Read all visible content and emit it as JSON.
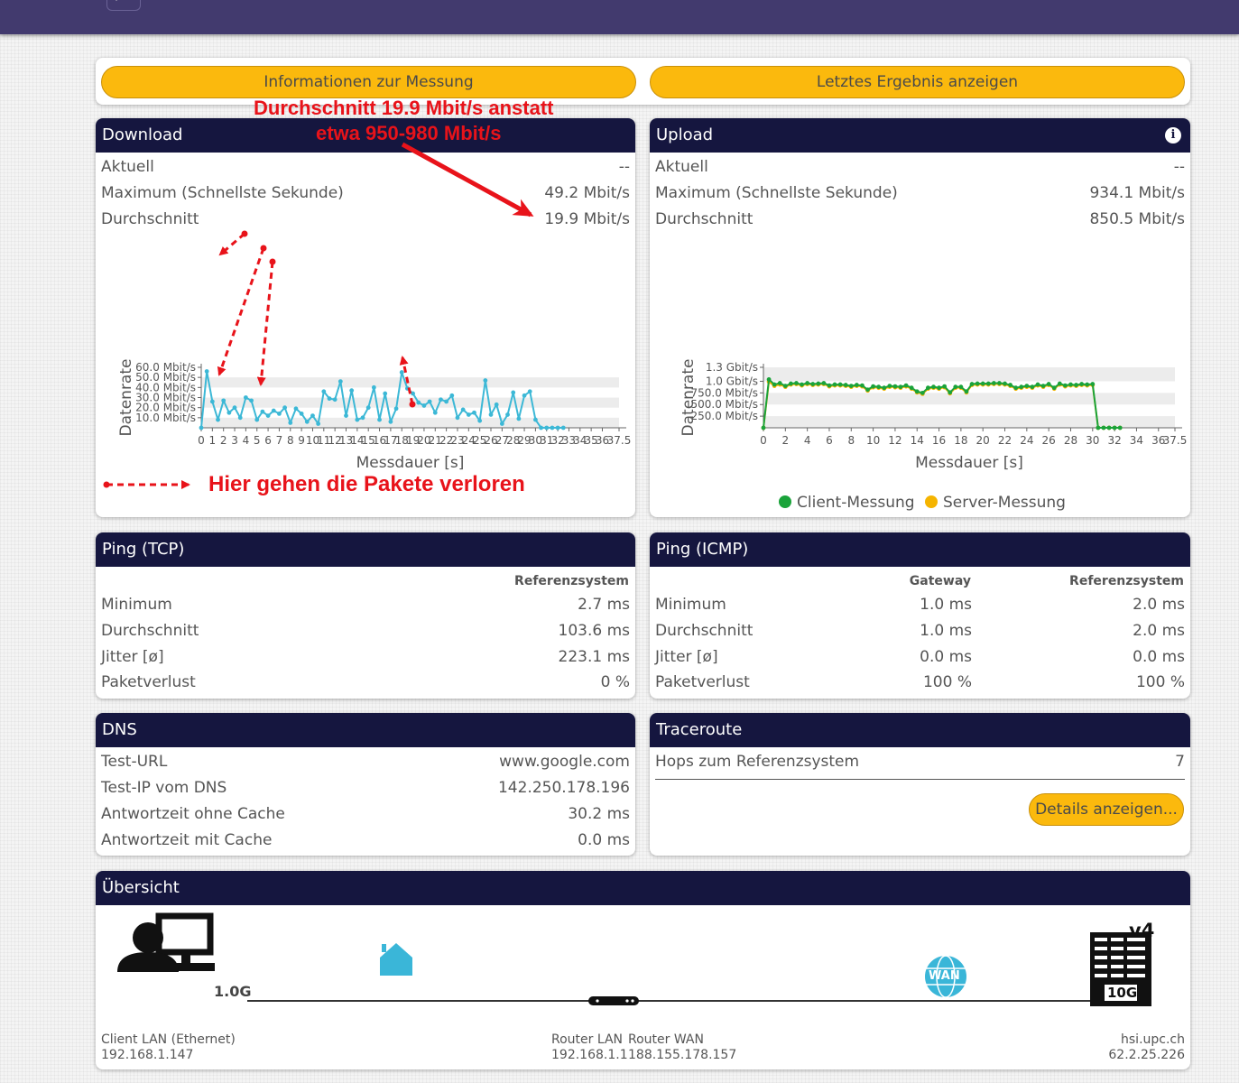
{
  "topbar": {
    "stub_label": "Q"
  },
  "actions": {
    "info_button": "Informationen zur Messung",
    "last_result_button": "Letztes Ergebnis anzeigen"
  },
  "download": {
    "title": "Download",
    "rows": [
      {
        "label": "Aktuell",
        "value": "--"
      },
      {
        "label": "Maximum (Schnellste Sekunde)",
        "value": "49.2 Mbit/s"
      },
      {
        "label": "Durchschnitt",
        "value": "19.9 Mbit/s"
      }
    ]
  },
  "upload": {
    "title": "Upload",
    "info_icon": "i",
    "rows": [
      {
        "label": "Aktuell",
        "value": "--"
      },
      {
        "label": "Maximum (Schnellste Sekunde)",
        "value": "934.1 Mbit/s"
      },
      {
        "label": "Durchschnitt",
        "value": "850.5 Mbit/s"
      }
    ],
    "legend_client": "Client-Messung",
    "legend_server": "Server-Messung"
  },
  "annotations": {
    "top_line1": "Durchschnitt 19.9 Mbit/s anstatt",
    "top_line2": "etwa 950-980 Mbit/s",
    "bottom": "Hier gehen die Pakete verloren"
  },
  "ping_tcp": {
    "title": "Ping (TCP)",
    "col": "Referenzsystem",
    "rows": [
      {
        "label": "Minimum",
        "value": "2.7 ms"
      },
      {
        "label": "Durchschnitt",
        "value": "103.6 ms"
      },
      {
        "label": "Jitter [ø]",
        "value": "223.1 ms"
      },
      {
        "label": "Paketverlust",
        "value": "0 %"
      }
    ]
  },
  "ping_icmp": {
    "title": "Ping (ICMP)",
    "col1": "Gateway",
    "col2": "Referenzsystem",
    "rows": [
      {
        "label": "Minimum",
        "gw": "1.0 ms",
        "ref": "2.0 ms"
      },
      {
        "label": "Durchschnitt",
        "gw": "1.0 ms",
        "ref": "2.0 ms"
      },
      {
        "label": "Jitter [ø]",
        "gw": "0.0 ms",
        "ref": "0.0 ms"
      },
      {
        "label": "Paketverlust",
        "gw": "100 %",
        "ref": "100 %"
      }
    ]
  },
  "dns": {
    "title": "DNS",
    "rows": [
      {
        "label": "Test-URL",
        "value": "www.google.com"
      },
      {
        "label": "Test-IP vom DNS",
        "value": "142.250.178.196"
      },
      {
        "label": "Antwortzeit ohne Cache",
        "value": "30.2 ms"
      },
      {
        "label": "Antwortzeit mit Cache",
        "value": "0.0 ms"
      }
    ]
  },
  "traceroute": {
    "title": "Traceroute",
    "hops_label": "Hops zum Referenzsystem",
    "hops_value": "7",
    "details_button": "Details anzeigen..."
  },
  "overview": {
    "title": "Übersicht",
    "client_speed": "1.0G",
    "lan_label": "LAN",
    "wan_label": "WAN",
    "server_speed": "10G",
    "server_ip_version": "v4",
    "client_name": "Client LAN (Ethernet)",
    "client_ip": "192.168.1.147",
    "router_lan_name": "Router LAN",
    "router_lan_ip": "192.168.1.1",
    "router_wan_name": "Router WAN",
    "router_wan_ip": "188.155.178.157",
    "server_name": "hsi.upc.ch",
    "server_ip": "62.2.25.226"
  },
  "colors": {
    "header_bg": "#15163f",
    "topbar_bg": "#423a6e",
    "button_yellow": "#fbb90d",
    "download_line": "#3cb8d6",
    "client_line": "#1aa33a",
    "server_line": "#f5b400",
    "annotation_red": "#e8131a"
  },
  "chart_data": [
    {
      "id": "download",
      "type": "line",
      "xlabel": "Messdauer [s]",
      "ylabel": "Datenrate",
      "xlim": [
        0,
        37.5
      ],
      "ylim": [
        0,
        60
      ],
      "y_ticks": [
        10,
        20,
        30,
        40,
        50,
        60
      ],
      "y_tick_labels": [
        "10.0 Mbit/s",
        "20.0 Mbit/s",
        "30.0 Mbit/s",
        "40.0 Mbit/s",
        "50.0 Mbit/s",
        "60.0 Mbit/s"
      ],
      "x_tick_labels": [
        "0",
        "1",
        "2",
        "3",
        "4",
        "5",
        "6",
        "7",
        "8",
        "9",
        "10",
        "11",
        "12",
        "13",
        "14",
        "15",
        "16",
        "17",
        "18",
        "19",
        "20",
        "21",
        "22",
        "23",
        "24",
        "25",
        "26",
        "27",
        "28",
        "29",
        "30",
        "31",
        "32",
        "33",
        "34",
        "35",
        "36",
        "37.5"
      ],
      "series": [
        {
          "x": [
            0,
            0.5,
            1,
            1.5,
            2,
            2.5,
            3,
            3.5,
            4,
            4.5,
            5,
            5.5,
            6,
            6.5,
            7,
            7.5,
            8,
            8.5,
            9,
            9.5,
            10,
            10.5,
            11,
            11.5,
            12,
            12.5,
            13,
            13.5,
            14,
            14.5,
            15,
            15.5,
            16,
            16.5,
            17,
            17.5,
            18,
            18.5,
            19,
            19.5,
            20,
            20.5,
            21,
            21.5,
            22,
            22.5,
            23,
            23.5,
            24,
            24.5,
            25,
            25.5,
            26,
            26.5,
            27,
            27.5,
            28,
            28.5,
            29,
            29.5,
            30,
            30.5,
            31,
            31.5,
            32,
            32.5
          ],
          "y": [
            0,
            56,
            26,
            8,
            27,
            15,
            20,
            10,
            30,
            27,
            8,
            16,
            12,
            17,
            14,
            20,
            5,
            19,
            14,
            6,
            12,
            4,
            36,
            29,
            28,
            46,
            12,
            37,
            8,
            10,
            20,
            40,
            8,
            34,
            6,
            19,
            55,
            39,
            34,
            25,
            22,
            26,
            15,
            28,
            26,
            32,
            10,
            18,
            13,
            15,
            7,
            47,
            13,
            23,
            4,
            13,
            35,
            9,
            32,
            36,
            8,
            0,
            0,
            0,
            0,
            0
          ]
        }
      ]
    },
    {
      "id": "upload",
      "type": "line",
      "xlabel": "Messdauer [s]",
      "ylabel": "Datenrate",
      "xlim": [
        0,
        37.5
      ],
      "ylim": [
        0,
        1300
      ],
      "y_ticks": [
        250,
        500,
        750,
        1000,
        1300
      ],
      "y_tick_labels": [
        "250.0 Mbit/s",
        "500.0 Mbit/s",
        "750.0 Mbit/s",
        "1.0 Gbit/s",
        "1.3 Gbit/s"
      ],
      "x_tick_labels": [
        "0",
        "2",
        "4",
        "6",
        "8",
        "10",
        "12",
        "14",
        "16",
        "18",
        "20",
        "22",
        "24",
        "26",
        "28",
        "30",
        "32",
        "34",
        "36",
        "37.5"
      ],
      "legend": "bottom",
      "series": [
        {
          "name": "Client-Messung",
          "x": [
            0,
            0.5,
            1,
            1.5,
            2,
            2.5,
            3,
            3.5,
            4,
            4.5,
            5,
            5.5,
            6,
            6.5,
            7,
            7.5,
            8,
            8.5,
            9,
            9.5,
            10,
            10.5,
            11,
            11.5,
            12,
            12.5,
            13,
            13.5,
            14,
            14.5,
            15,
            15.5,
            16,
            16.5,
            17,
            17.5,
            18,
            18.5,
            19,
            19.5,
            20,
            20.5,
            21,
            21.5,
            22,
            22.5,
            23,
            23.5,
            24,
            24.5,
            25,
            25.5,
            26,
            26.5,
            27,
            27.5,
            28,
            28.5,
            29,
            29.5,
            30,
            30.5,
            31,
            31.5,
            32,
            32.5
          ],
          "y": [
            0,
            1040,
            930,
            960,
            900,
            950,
            960,
            930,
            960,
            940,
            950,
            960,
            910,
            930,
            930,
            920,
            900,
            920,
            910,
            820,
            890,
            880,
            860,
            900,
            890,
            880,
            910,
            860,
            780,
            750,
            860,
            880,
            860,
            890,
            760,
            880,
            880,
            780,
            940,
            950,
            950,
            950,
            960,
            960,
            950,
            920,
            860,
            880,
            900,
            880,
            930,
            900,
            940,
            860,
            950,
            910,
            930,
            920,
            940,
            930,
            940,
            0,
            0,
            0,
            0,
            0
          ]
        },
        {
          "name": "Server-Messung",
          "x": [
            0,
            0.5,
            1,
            1.5,
            2,
            2.5,
            3,
            3.5,
            4,
            4.5,
            5,
            5.5,
            6,
            6.5,
            7,
            7.5,
            8,
            8.5,
            9,
            9.5,
            10,
            10.5,
            11,
            11.5,
            12,
            12.5,
            13,
            13.5,
            14,
            14.5,
            15,
            15.5,
            16,
            16.5,
            17,
            17.5,
            18,
            18.5,
            19,
            19.5,
            20,
            20.5,
            21,
            21.5,
            22,
            22.5,
            23,
            23.5,
            24,
            24.5,
            25,
            25.5,
            26,
            26.5,
            27,
            27.5,
            28,
            28.5,
            29,
            29.5,
            30,
            30.5,
            31,
            31.5,
            32,
            32.5
          ],
          "y": [
            0,
            990,
            900,
            930,
            880,
            930,
            940,
            910,
            940,
            920,
            930,
            940,
            890,
            910,
            910,
            900,
            880,
            900,
            890,
            800,
            870,
            860,
            840,
            880,
            870,
            860,
            890,
            840,
            760,
            730,
            840,
            860,
            840,
            870,
            740,
            860,
            860,
            760,
            920,
            930,
            930,
            930,
            940,
            940,
            930,
            900,
            840,
            860,
            880,
            860,
            910,
            880,
            920,
            840,
            930,
            890,
            910,
            900,
            920,
            910,
            920,
            0,
            0,
            0,
            0,
            0
          ]
        }
      ]
    }
  ]
}
